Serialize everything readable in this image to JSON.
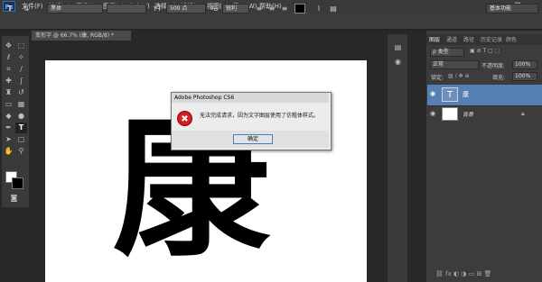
{
  "app": {
    "logo": "Ps"
  },
  "menu": [
    "文件(F)",
    "编辑(E)",
    "图像(I)",
    "图层(L)",
    "文字(Y)",
    "选择(S)",
    "滤镜(T)",
    "视图(V)",
    "窗口(W)",
    "帮助(H)"
  ],
  "window_controls": {
    "minimize": "—",
    "restore": "❐",
    "close": "✕"
  },
  "options": {
    "tool_glyph": "T",
    "font_family": "黑体",
    "font_size": "500 点",
    "antialias": "锐利",
    "workspace": "基本功能"
  },
  "document": {
    "tab_title": "变形字 @ 66.7% (康, RGB/8) *",
    "big_char": "康"
  },
  "panels": {
    "tabs": [
      "图层",
      "通道",
      "路径",
      "历史记录",
      "颜色"
    ],
    "filter_label": "ρ 类型",
    "blend_mode": "正常",
    "opacity_label": "不透明度:",
    "opacity_value": "100%",
    "lock_label": "锁定:",
    "fill_label": "填充:",
    "fill_value": "100%",
    "layers": [
      {
        "name": "康",
        "thumb": "T"
      },
      {
        "name": "背景",
        "thumb": ""
      }
    ]
  },
  "dialog": {
    "title": "Adobe Photoshop CS6",
    "icon": "✖",
    "message": "无法完成请求，因为文字图层使用了仿粗体样式。",
    "ok_label": "确定"
  },
  "colors": {
    "accent": "#5680b4",
    "error": "#d21f1f",
    "bg": "#282828"
  }
}
